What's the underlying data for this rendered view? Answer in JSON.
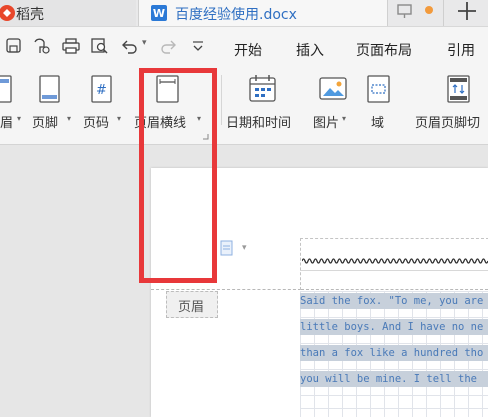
{
  "tabs": {
    "app_tab": "稻壳",
    "doc_tab": "百度经验使用.docx"
  },
  "menu": {
    "items": [
      "开始",
      "插入",
      "页面布局",
      "引用"
    ]
  },
  "ribbon": {
    "items": [
      "眉",
      "页脚",
      "页码",
      "页眉横线",
      "日期和时间",
      "图片",
      "域",
      "页眉页脚切"
    ]
  },
  "document": {
    "header_label": "页眉",
    "lines": [
      "Said the fox. \"To me, you are",
      "little boys. And I have no ne",
      "than a fox like a hundred tho",
      "you will be mine. I tell the"
    ]
  },
  "colors": {
    "highlight_box": "#e8383a",
    "doc_accent": "#2b79d6",
    "header_body_text": "#4a7ab8"
  }
}
